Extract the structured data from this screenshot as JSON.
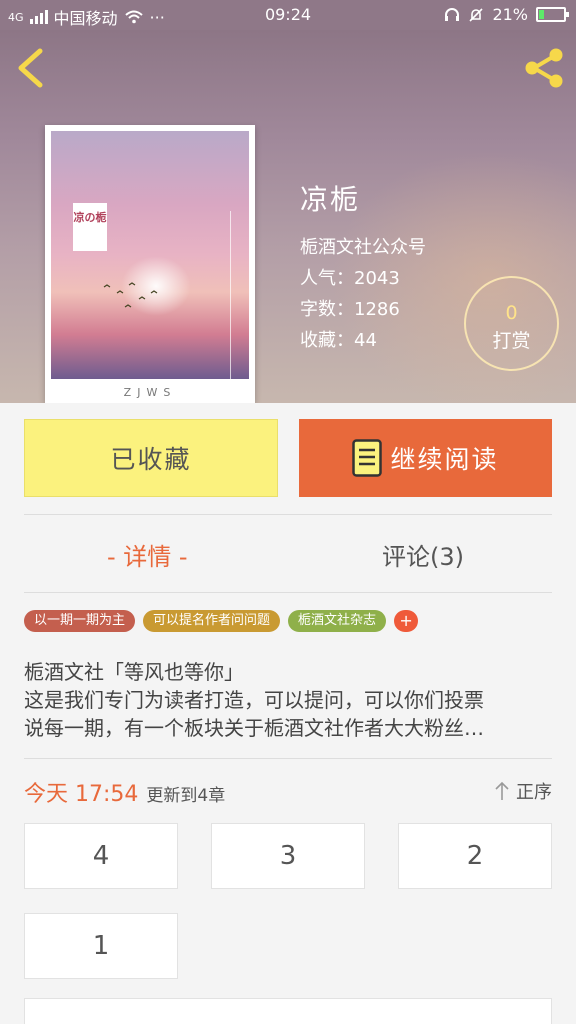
{
  "status_bar": {
    "network": "4G",
    "carrier": "中国移动",
    "more": "···",
    "time": "09:24",
    "battery": "21%",
    "battery_level": 0.21
  },
  "book": {
    "title": "凉栀",
    "author": "栀酒文社公众号",
    "popularity": "人气：2043",
    "word_count": "字数：1286",
    "favorites": "收藏：44",
    "cover_tag": "凉の栀",
    "cover_brand": "ZJWS"
  },
  "reward": {
    "count": "0",
    "label": "打赏"
  },
  "actions": {
    "favorited_label": "已收藏",
    "continue_label": "继续阅读"
  },
  "tabs": {
    "detail": "- 详情 -",
    "comments": "评论(3)"
  },
  "tags": [
    {
      "label": "以一期一期为主",
      "color": "#c45f4e"
    },
    {
      "label": "可以提名作者问问题",
      "color": "#c99a32"
    },
    {
      "label": "栀酒文社杂志",
      "color": "#8fb04a"
    }
  ],
  "tag_add": "+",
  "description": [
    "栀酒文社「等风也等你」",
    "这是我们专门为读者打造，可以提问，可以你们投票",
    "说每一期，有一个板块关于栀酒文社作者大大粉丝…"
  ],
  "update": {
    "when": "今天 17:54",
    "note": "更新到4章"
  },
  "sort_label": "正序",
  "chapters": [
    "4",
    "3",
    "2",
    "1"
  ],
  "colors": {
    "accent": "#e8693b",
    "favorite_button": "#fbf27e"
  }
}
